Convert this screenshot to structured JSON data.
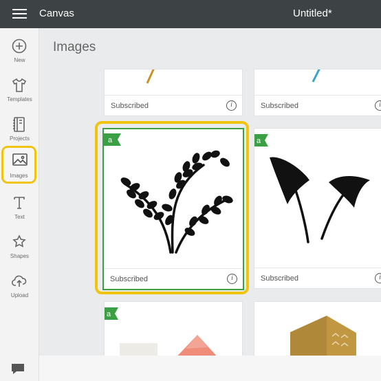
{
  "header": {
    "app_title": "Canvas",
    "doc_title": "Untitled*"
  },
  "sidebar": {
    "items": [
      {
        "label": "New",
        "icon": "plus-circle-icon"
      },
      {
        "label": "Templates",
        "icon": "tshirt-icon"
      },
      {
        "label": "Projects",
        "icon": "notebook-icon"
      },
      {
        "label": "Images",
        "icon": "image-icon",
        "active": true
      },
      {
        "label": "Text",
        "icon": "text-t-icon"
      },
      {
        "label": "Shapes",
        "icon": "shapes-icon"
      },
      {
        "label": "Upload",
        "icon": "cloud-upload-icon"
      }
    ],
    "chat_icon": "chat-bubble-icon"
  },
  "main": {
    "title": "Images",
    "cards": [
      {
        "status": "Subscribed",
        "info": "i"
      },
      {
        "status": "Subscribed",
        "info": "i"
      },
      {
        "status": "Subscribed",
        "info": "i",
        "badge": "a",
        "selected": true,
        "image": "fern-leaves"
      },
      {
        "status": "Subscribed",
        "info": "i",
        "badge": "a",
        "image": "calla-lilies"
      },
      {
        "badge": "a",
        "image": "paper-craft"
      },
      {
        "image": "folded-card"
      }
    ]
  },
  "colors": {
    "topbar": "#3d4245",
    "highlight": "#f1c40f",
    "selected_border": "#3aa043",
    "badge": "#3aa043"
  }
}
